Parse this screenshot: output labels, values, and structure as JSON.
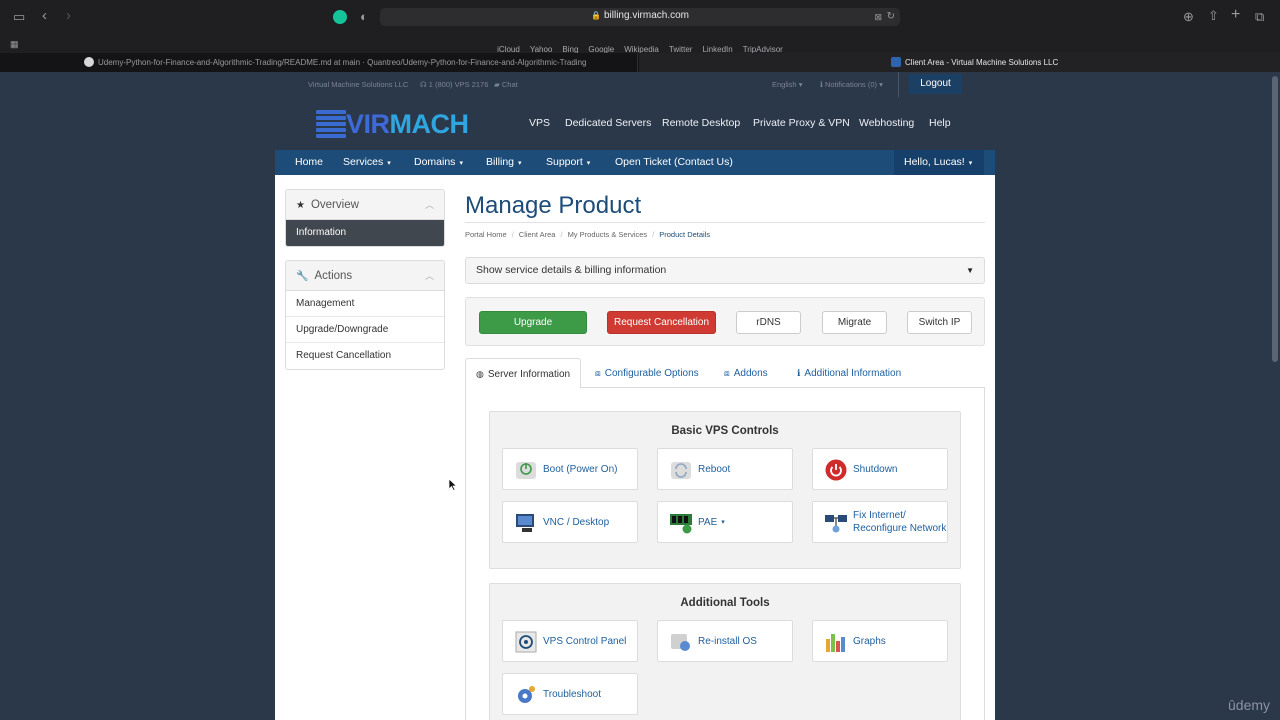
{
  "browser": {
    "url": "billing.virmach.com",
    "favorites": [
      "iCloud",
      "Yahoo",
      "Bing",
      "Google",
      "Wikipedia",
      "Twitter",
      "LinkedIn",
      "TripAdvisor"
    ],
    "tabs": [
      {
        "title": "Udemy-Python-for-Finance-and-Algorithmic-Trading/README.md at main · Quantreo/Udemy-Python-for-Finance-and-Algorithmic-Trading"
      },
      {
        "title": "Client Area - Virtual Machine Solutions LLC"
      }
    ]
  },
  "topbar": {
    "company": "Virtual Machine Solutions LLC",
    "phone": "1 (800) VPS 2176",
    "chat": "Chat",
    "language": "English",
    "notifications": "Notifications (0)",
    "logout": "Logout"
  },
  "logo": {
    "part1": "VIR",
    "part2": "MACH"
  },
  "mainnav": [
    "VPS",
    "Dedicated Servers",
    "Remote Desktop",
    "Private Proxy & VPN",
    "Webhosting",
    "Help"
  ],
  "navbar": {
    "items": [
      "Home",
      "Services",
      "Domains",
      "Billing",
      "Support",
      "Open Ticket (Contact Us)"
    ],
    "user": "Hello, Lucas!"
  },
  "sidebar": {
    "overview_title": "Overview",
    "overview_items": [
      "Information"
    ],
    "actions_title": "Actions",
    "actions_items": [
      "Management",
      "Upgrade/Downgrade",
      "Request Cancellation"
    ]
  },
  "page": {
    "title": "Manage Product",
    "breadcrumb": [
      "Portal Home",
      "Client Area",
      "My Products & Services",
      "Product Details"
    ],
    "details_toggle": "Show service details & billing information"
  },
  "actions": {
    "upgrade": "Upgrade",
    "cancel": "Request Cancellation",
    "rdns": "rDNS",
    "migrate": "Migrate",
    "switch_ip": "Switch IP"
  },
  "tabs": [
    "Server Information",
    "Configurable Options",
    "Addons",
    "Additional Information"
  ],
  "basic_controls": {
    "title": "Basic VPS Controls",
    "boot": "Boot (Power On)",
    "reboot": "Reboot",
    "shutdown": "Shutdown",
    "vnc": "VNC / Desktop",
    "pae": "PAE",
    "fix_line1": "Fix Internet/",
    "fix_line2": "Reconfigure Network"
  },
  "additional_tools": {
    "title": "Additional Tools",
    "control_panel": "VPS Control Panel",
    "reinstall": "Re-install OS",
    "graphs": "Graphs",
    "troubleshoot": "Troubleshoot"
  },
  "watermark": "ûdemy",
  "colors": {
    "brand": "#1d4c79",
    "green": "#3d9a47",
    "red": "#cf3a33"
  }
}
